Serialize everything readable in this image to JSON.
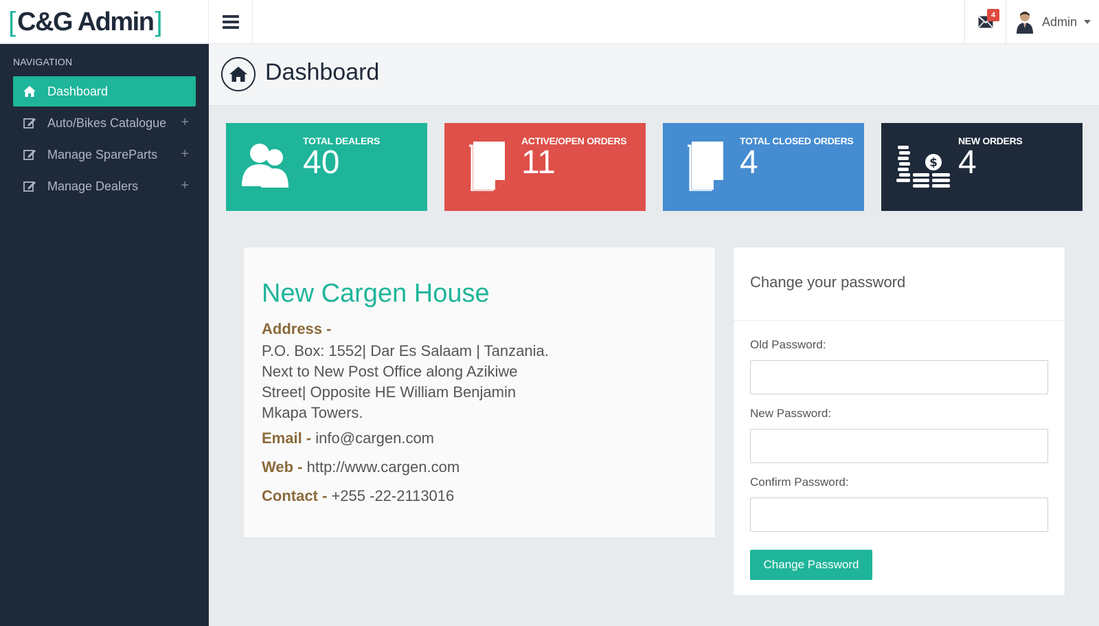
{
  "brand": {
    "open": "[",
    "name": "C&G Admin",
    "close": "]"
  },
  "topbar": {
    "menu_icon": "hamburger-icon",
    "mail_icon": "envelope-icon",
    "mail_count": "4",
    "user_name": "Admin",
    "avatar_icon": "user-avatar-icon"
  },
  "sidebar": {
    "heading": "NAVIGATION",
    "items": [
      {
        "label": "Dashboard",
        "icon": "home-icon",
        "active": true
      },
      {
        "label": "Auto/Bikes Catalogue",
        "icon": "edit-icon",
        "expand": "+"
      },
      {
        "label": "Manage SpareParts",
        "icon": "edit-icon",
        "expand": "+"
      },
      {
        "label": "Manage Dealers",
        "icon": "edit-icon",
        "expand": "+"
      }
    ]
  },
  "page": {
    "title": "Dashboard"
  },
  "stats": [
    {
      "label": "TOTAL DEALERS",
      "value": "40",
      "color": "#1fb59a",
      "icon": "users-icon"
    },
    {
      "label": "ACTIVE/OPEN ORDERS",
      "value": "11",
      "color": "#de5049",
      "icon": "document-icon"
    },
    {
      "label": "TOTAL CLOSED ORDERS",
      "value": "4",
      "color": "#458cd1",
      "icon": "document-icon"
    },
    {
      "label": "NEW ORDERS",
      "value": "4",
      "color": "#1e2a3a",
      "icon": "money-icon"
    }
  ],
  "company": {
    "name": "New Cargen House",
    "address_label": "Address -",
    "address": "P.O. Box: 1552| Dar Es Salaam | Tanzania. Next to New Post Office along Azikiwe Street| Opposite HE William Benjamin Mkapa Towers.",
    "email_label": "Email -",
    "email": "info@cargen.com",
    "web_label": "Web -",
    "web": "http://www.cargen.com",
    "contact_label": "Contact -",
    "contact": "+255 -22-2113016"
  },
  "password_form": {
    "title": "Change your password",
    "old_label": "Old Password:",
    "new_label": "New Password:",
    "confirm_label": "Confirm Password:",
    "old_value": "",
    "new_value": "",
    "confirm_value": "",
    "submit_label": "Change Password"
  }
}
